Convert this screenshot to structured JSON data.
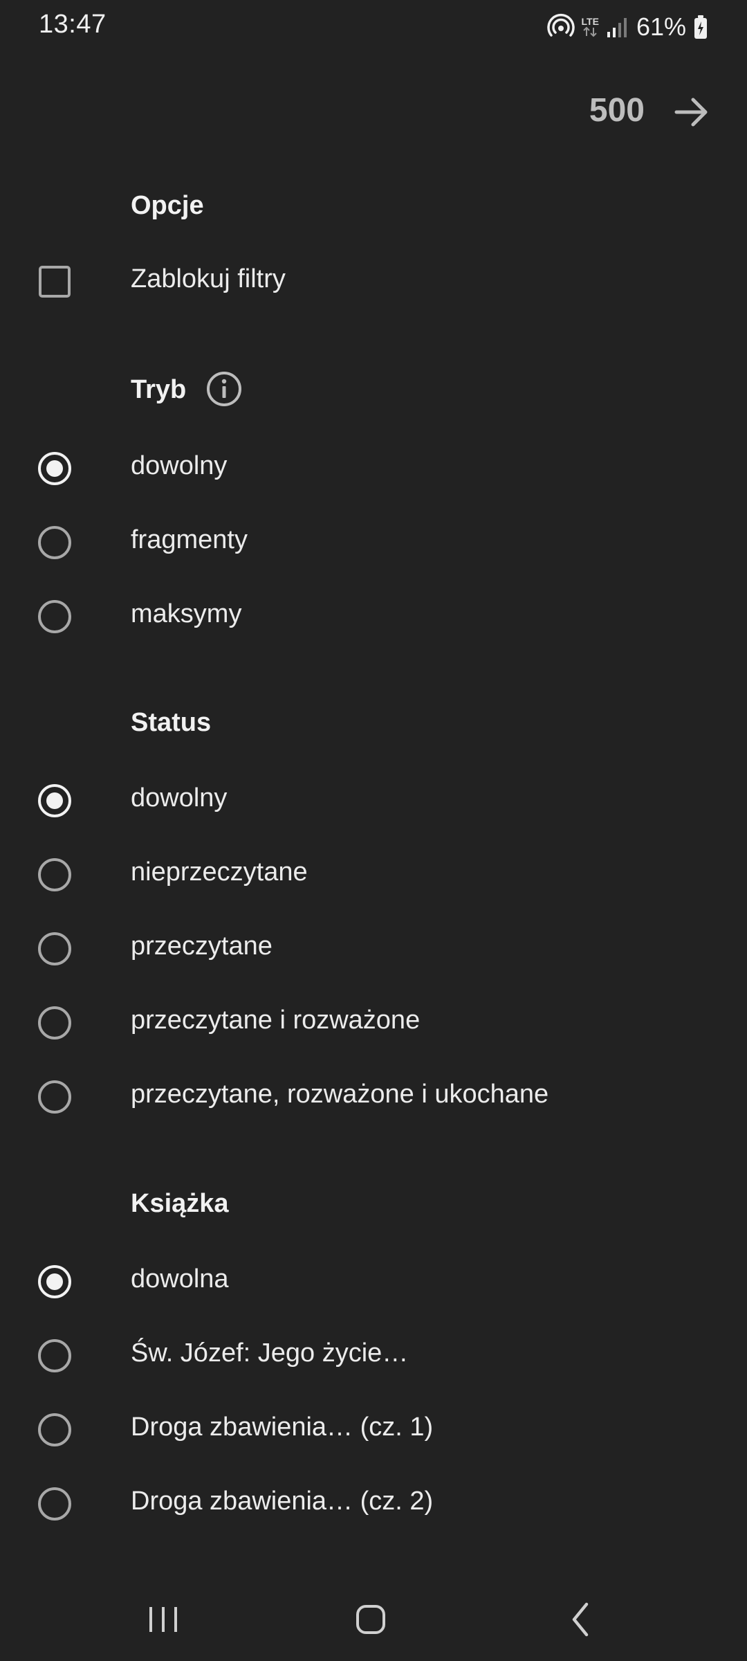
{
  "status_bar": {
    "time": "13:47",
    "network": "LTE",
    "battery": "61%"
  },
  "top_bar": {
    "count": "500",
    "arrow_icon": "arrow-right-icon"
  },
  "sections": {
    "options": {
      "title": "Opcje",
      "items": [
        {
          "label": "Zablokuj filtry",
          "checked": false
        }
      ]
    },
    "mode": {
      "title": "Tryb",
      "info_icon": "info-icon",
      "items": [
        {
          "label": "dowolny",
          "selected": true
        },
        {
          "label": "fragmenty",
          "selected": false
        },
        {
          "label": "maksymy",
          "selected": false
        }
      ]
    },
    "status": {
      "title": "Status",
      "items": [
        {
          "label": "dowolny",
          "selected": true
        },
        {
          "label": "nieprzeczytane",
          "selected": false
        },
        {
          "label": "przeczytane",
          "selected": false
        },
        {
          "label": "przeczytane i rozważone",
          "selected": false
        },
        {
          "label": "przeczytane, rozważone i ukochane",
          "selected": false
        }
      ]
    },
    "book": {
      "title": "Książka",
      "items": [
        {
          "label": "dowolna",
          "selected": true
        },
        {
          "label": "Św. Józef: Jego życie…",
          "selected": false
        },
        {
          "label": "Droga zbawienia… (cz. 1)",
          "selected": false
        },
        {
          "label": "Droga zbawienia… (cz. 2)",
          "selected": false
        }
      ]
    }
  },
  "nav_bar": {
    "recents_icon": "recents-icon",
    "home_icon": "home-icon",
    "back_icon": "back-icon"
  },
  "colors": {
    "background": "#222222",
    "text": "#ECECEC",
    "muted": "#BDBDBD",
    "control": "#A8A8A8",
    "selected_dot": "#F2F2F2"
  }
}
